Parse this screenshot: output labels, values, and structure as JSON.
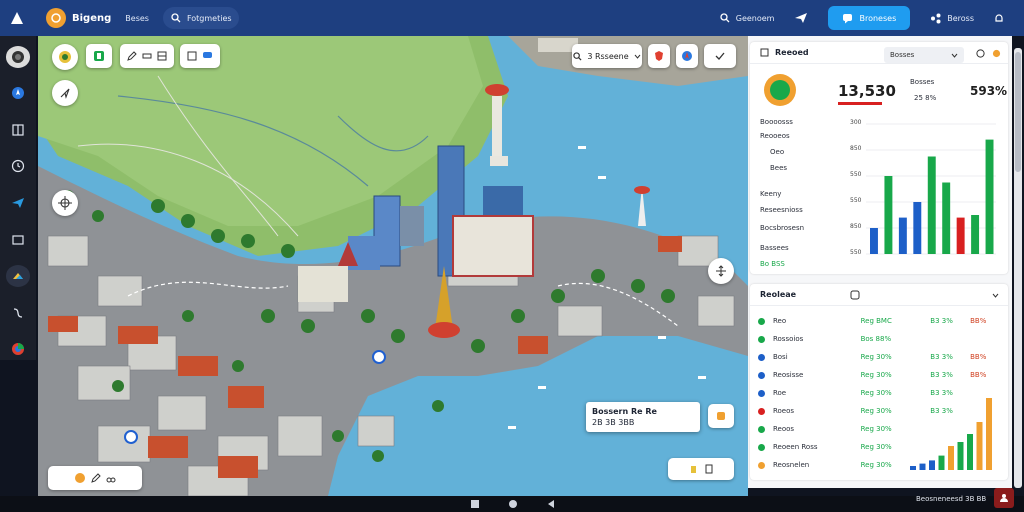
{
  "header": {
    "brand": "Bigeng",
    "link1": "Beses",
    "search_label": "Fotgmeties",
    "item1": "Geenoem",
    "primary_button": "Broneses",
    "item2": "Beross"
  },
  "map_toolbar": {
    "filter_label": "3 Rsseene",
    "popup_title": "Bossern Re Re",
    "popup_sub": "2B 3B 3BB"
  },
  "panel": {
    "card1_title": "Reeoed",
    "card1_select": "Bosses",
    "value_main": "13,530",
    "value_sub": "25 8%",
    "value_right_label": "Bosses",
    "value_right": "593%",
    "label_a": "Boooosss",
    "label_b": "Reooeos",
    "label_c": "Oeo",
    "label_d": "Bees",
    "label_e": "Keeny",
    "label_f": "Reseesnioss",
    "label_g": "Bocsbrosesn",
    "label_h": "Bassees",
    "label_i": "Bo BSS",
    "axis": [
      "300",
      "850",
      "550",
      "550",
      "850",
      "550"
    ],
    "bars_top": [
      {
        "h": 0.2,
        "c": "#1d5fc8"
      },
      {
        "h": 0.6,
        "c": "#18a84a"
      },
      {
        "h": 0.28,
        "c": "#1d5fc8"
      },
      {
        "h": 0.4,
        "c": "#1d5fc8"
      },
      {
        "h": 0.75,
        "c": "#18a84a"
      },
      {
        "h": 0.55,
        "c": "#18a84a"
      },
      {
        "h": 0.28,
        "c": "#d82020"
      },
      {
        "h": 0.3,
        "c": "#18a84a"
      },
      {
        "h": 0.88,
        "c": "#18a84a"
      }
    ],
    "card2_title": "Reoleae",
    "rows": [
      {
        "dot": "#18a84a",
        "name": "Reo",
        "v1": "Reg BMC",
        "v2": "B3 3%",
        "v3": "BB%"
      },
      {
        "dot": "#18a84a",
        "name": "Rossoios",
        "v1": "Bos 88%",
        "v2": "",
        "v3": ""
      },
      {
        "dot": "#1d5fc8",
        "name": "Bosi",
        "v1": "Reg 30%",
        "v2": "B3 3%",
        "v3": "BB%"
      },
      {
        "dot": "#1d5fc8",
        "name": "Reosisse",
        "v1": "Reg 30%",
        "v2": "B3 3%",
        "v3": "BB%"
      },
      {
        "dot": "#1d5fc8",
        "name": "Roe",
        "v1": "Reg 30%",
        "v2": "B3 3%",
        "v3": ""
      },
      {
        "dot": "#d82020",
        "name": "Roeos",
        "v1": "Reg 30%",
        "v2": "B3 3%",
        "v3": ""
      },
      {
        "dot": "#18a84a",
        "name": "Reoos",
        "v1": "Reg 30%",
        "v2": "",
        "v3": ""
      },
      {
        "dot": "#18a84a",
        "name": "Reoeen Ross",
        "v1": "Reg 30%",
        "v2": "",
        "v3": ""
      },
      {
        "dot": "#f0a030",
        "name": "Reosnelen",
        "v1": "Reg 30%",
        "v2": "",
        "v3": ""
      }
    ]
  },
  "status": "Beosneneesd 3B BB"
}
